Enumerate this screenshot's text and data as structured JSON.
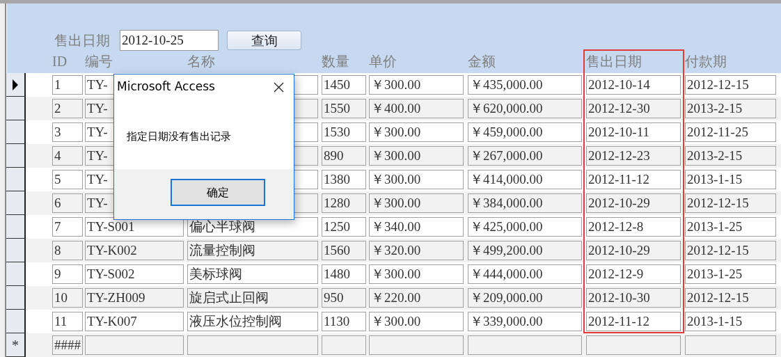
{
  "filter": {
    "label": "售出日期",
    "value": "2012-10-25",
    "button": "查询"
  },
  "columns": [
    {
      "label": "ID",
      "highlighted": false
    },
    {
      "label": "编号",
      "highlighted": false
    },
    {
      "label": "名称",
      "highlighted": false
    },
    {
      "label": "数量",
      "highlighted": false
    },
    {
      "label": "单价",
      "highlighted": false
    },
    {
      "label": "金额",
      "highlighted": false
    },
    {
      "label": "售出日期",
      "highlighted": true
    },
    {
      "label": "付款期",
      "highlighted": false
    }
  ],
  "rows": [
    {
      "selected": true,
      "id": "1",
      "code": "TY-",
      "qty": "1450",
      "price": "￥300.00",
      "amount": "￥435,000.00",
      "sale_date": "2012-10-14",
      "pay_date": "2012-12-15"
    },
    {
      "selected": false,
      "id": "2",
      "code": "TY-",
      "qty": "1550",
      "price": "￥400.00",
      "amount": "￥620,000.00",
      "sale_date": "2012-12-30",
      "pay_date": "2013-2-15"
    },
    {
      "selected": false,
      "id": "3",
      "code": "TY-",
      "qty": "1530",
      "price": "￥300.00",
      "amount": "￥459,000.00",
      "sale_date": "2012-10-11",
      "pay_date": "2012-11-25"
    },
    {
      "selected": false,
      "id": "4",
      "code": "TY-",
      "qty": "890",
      "price": "￥300.00",
      "amount": "￥267,000.00",
      "sale_date": "2012-12-23",
      "pay_date": "2013-2-15"
    },
    {
      "selected": false,
      "id": "5",
      "code": "TY-",
      "qty": "1380",
      "price": "￥300.00",
      "amount": "￥414,000.00",
      "sale_date": "2012-11-12",
      "pay_date": "2013-1-15"
    },
    {
      "selected": false,
      "id": "6",
      "code": "TY-",
      "qty": "1280",
      "price": "￥300.00",
      "amount": "￥384,000.00",
      "sale_date": "2012-10-29",
      "pay_date": "2012-12-15"
    },
    {
      "selected": false,
      "id": "7",
      "code": "TY-S001",
      "name": "偏心半球阀",
      "qty": "1250",
      "price": "￥340.00",
      "amount": "￥425,000.00",
      "sale_date": "2012-12-8",
      "pay_date": "2013-1-25"
    },
    {
      "selected": false,
      "id": "8",
      "code": "TY-K002",
      "name": "流量控制阀",
      "qty": "1560",
      "price": "￥320.00",
      "amount": "￥499,200.00",
      "sale_date": "2012-10-29",
      "pay_date": "2012-12-15"
    },
    {
      "selected": false,
      "id": "9",
      "code": "TY-S002",
      "name": "美标球阀",
      "qty": "1480",
      "price": "￥300.00",
      "amount": "￥444,000.00",
      "sale_date": "2012-12-9",
      "pay_date": "2013-1-25"
    },
    {
      "selected": false,
      "id": "10",
      "code": "TY-ZH009",
      "name": "旋启式止回阀",
      "qty": "950",
      "price": "￥220.00",
      "amount": "￥209,000.00",
      "sale_date": "2012-10-30",
      "pay_date": "2012-12-15"
    },
    {
      "selected": false,
      "id": "11",
      "code": "TY-K007",
      "name": "液压水位控制阀",
      "qty": "1130",
      "price": "￥300.00",
      "amount": "￥339,000.00",
      "sale_date": "2012-11-12",
      "pay_date": "2013-1-15"
    }
  ],
  "new_row": {
    "marker": "*",
    "id": "####"
  },
  "dialog": {
    "title": "Microsoft Access",
    "message": "指定日期没有售出记录",
    "button": "确定"
  }
}
